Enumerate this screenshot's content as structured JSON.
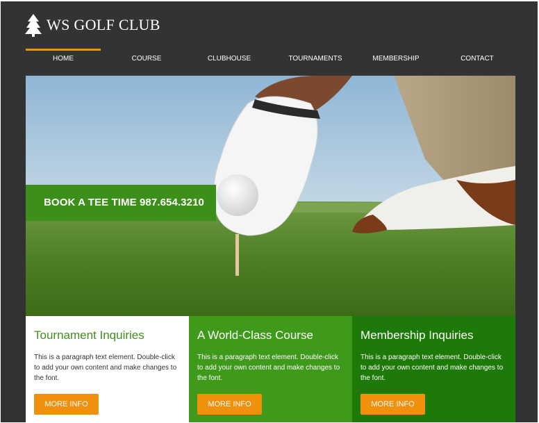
{
  "brand": {
    "name": "WS GOLF CLUB",
    "icon": "pine-tree-icon"
  },
  "nav": {
    "items": [
      {
        "label": "HOME",
        "active": true
      },
      {
        "label": "COURSE",
        "active": false
      },
      {
        "label": "CLUBHOUSE",
        "active": false
      },
      {
        "label": "TOURNAMENTS",
        "active": false
      },
      {
        "label": "MEMBERSHIP",
        "active": false
      },
      {
        "label": "CONTACT",
        "active": false
      }
    ]
  },
  "hero": {
    "tee_banner": "BOOK A TEE TIME 987.654.3210"
  },
  "columns": [
    {
      "title": "Tournament Inquiries",
      "text": "This is a paragraph text element. Double-click to add your own content and make changes to the font.",
      "button": "MORE INFO"
    },
    {
      "title": "A World-Class Course",
      "text": "This is a paragraph text element. Double-click to add your own content and make changes to the font.",
      "button": "MORE INFO"
    },
    {
      "title": "Membership Inquiries",
      "text": "This is a paragraph text element. Double-click to add your own content and make changes to the font.",
      "button": "MORE INFO"
    }
  ],
  "colors": {
    "header_bg": "#333333",
    "accent_orange": "#f0900d",
    "green_primary": "#3d8f1c",
    "green_mid": "#3f9a1b",
    "green_dark": "#1e7a08"
  }
}
